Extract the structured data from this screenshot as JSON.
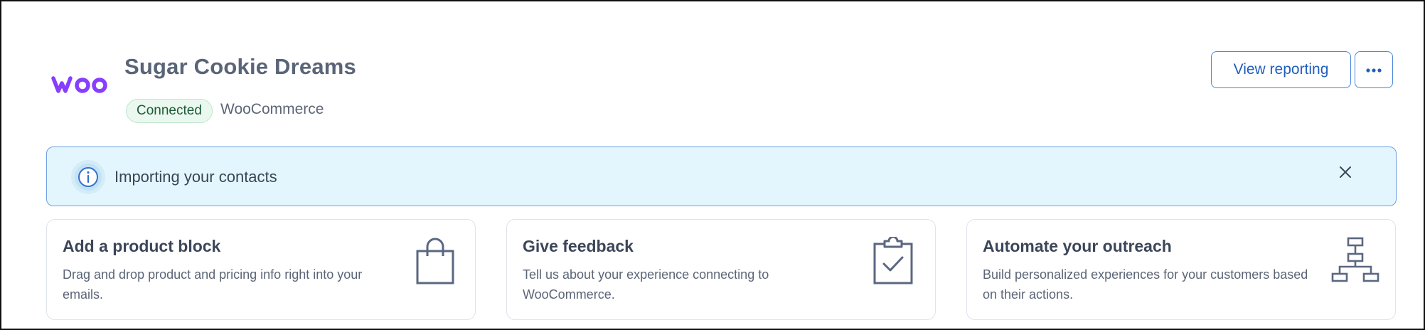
{
  "header": {
    "logo_text": "woo",
    "store_name": "Sugar Cookie Dreams",
    "status_badge": "Connected",
    "platform": "WooCommerce",
    "view_reporting_label": "View reporting",
    "more_options_icon": "ellipsis-icon"
  },
  "alert": {
    "message": "Importing your contacts",
    "icon": "info-icon",
    "close_icon": "close-icon"
  },
  "cards": [
    {
      "title": "Add a product block",
      "description": "Drag and drop product and pricing info right into your emails.",
      "icon": "shopping-bag-icon"
    },
    {
      "title": "Give feedback",
      "description": "Tell us about your experience connecting to WooCommerce.",
      "icon": "clipboard-check-icon"
    },
    {
      "title": "Automate your outreach",
      "description": "Build personalized experiences for your customers based on their actions.",
      "icon": "workflow-icon"
    }
  ],
  "colors": {
    "brand_purple": "#873eff",
    "accent_blue": "#1f5fbf",
    "alert_bg": "#e3f6fd",
    "badge_bg": "#eaf8ef",
    "badge_text": "#1f5a36"
  }
}
